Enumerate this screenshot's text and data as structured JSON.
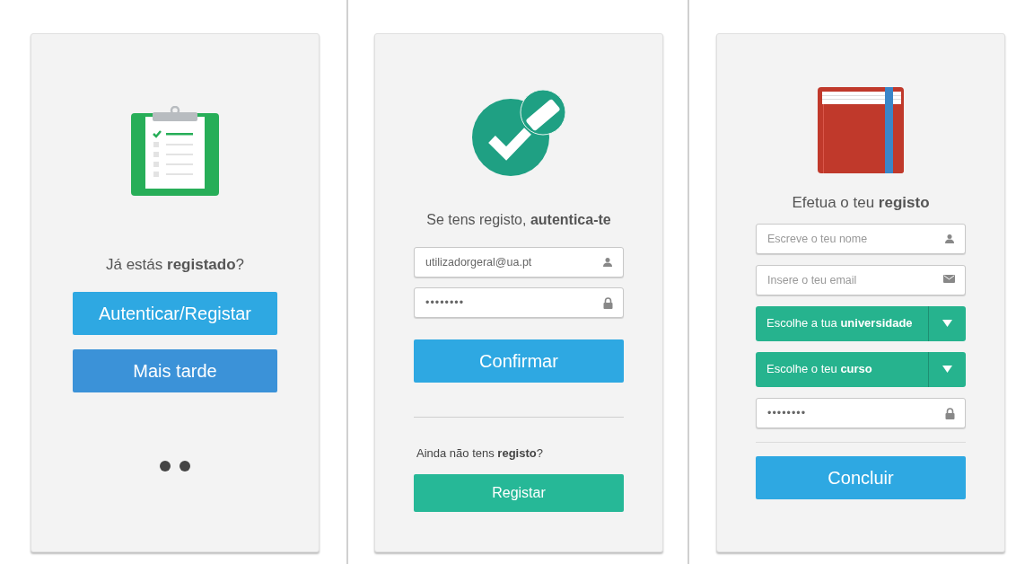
{
  "panels": [
    {
      "kind": "intro",
      "heading": "Já estás **registado**?",
      "buttons": [
        {
          "label": "Autenticar/Registar",
          "kind": "primary"
        },
        {
          "label": "Mais tarde",
          "kind": "secondary"
        }
      ]
    },
    {
      "kind": "login",
      "heading": "Se tens registo, **autentica-te**",
      "fields": [
        {
          "kind": "login",
          "value": "utilizadorgeral@ua.pt"
        },
        {
          "kind": "password",
          "value": "••••••••"
        }
      ],
      "button": "Confirmar",
      "footer_text": "Ainda não tens **registo**?",
      "footer_button": "Registar"
    },
    {
      "kind": "signup",
      "heading": "Efetua o teu **registo**",
      "fields": [
        {
          "kind": "name",
          "placeholder": "Escreve o teu nome"
        },
        {
          "kind": "email",
          "placeholder": "Insere o teu email"
        },
        {
          "kind": "select",
          "label": "Escolhe a tua **universidade**"
        },
        {
          "kind": "select",
          "label": "Escolhe o teu **curso**"
        },
        {
          "kind": "password",
          "value": "••••••••"
        }
      ],
      "button": "Concluir"
    }
  ]
}
